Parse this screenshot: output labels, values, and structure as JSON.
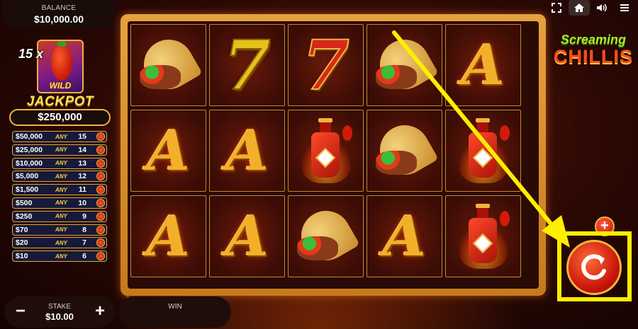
{
  "balance": {
    "label": "BALANCE",
    "value": "$10,000.00"
  },
  "wild": {
    "multiplier": "15 x",
    "label": "WILD"
  },
  "jackpot": {
    "title": "JACKPOT",
    "amount": "$250,000",
    "table": [
      {
        "amount": "$50,000",
        "any": "ANY",
        "count": "15"
      },
      {
        "amount": "$25,000",
        "any": "ANY",
        "count": "14"
      },
      {
        "amount": "$10,000",
        "any": "ANY",
        "count": "13"
      },
      {
        "amount": "$5,000",
        "any": "ANY",
        "count": "12"
      },
      {
        "amount": "$1,500",
        "any": "ANY",
        "count": "11"
      },
      {
        "amount": "$500",
        "any": "ANY",
        "count": "10"
      },
      {
        "amount": "$250",
        "any": "ANY",
        "count": "9"
      },
      {
        "amount": "$70",
        "any": "ANY",
        "count": "8"
      },
      {
        "amount": "$20",
        "any": "ANY",
        "count": "7"
      },
      {
        "amount": "$10",
        "any": "ANY",
        "count": "6"
      }
    ]
  },
  "stake": {
    "label": "STAKE",
    "value": "$10.00",
    "minus": "−",
    "plus": "+"
  },
  "win": {
    "label": "WIN"
  },
  "logo": {
    "line1": "Screaming",
    "line2": "CHILLIS"
  },
  "reels": [
    [
      "taco",
      "A",
      "A"
    ],
    [
      "7-yellow",
      "A",
      "A"
    ],
    [
      "7-red",
      "sauce",
      "taco"
    ],
    [
      "taco",
      "taco",
      "A"
    ],
    [
      "A",
      "sauce",
      "sauce"
    ]
  ],
  "symbols": {
    "A": "A",
    "seven": "7"
  },
  "buttons": {
    "spin": "C",
    "bet_plus": "+"
  },
  "icons": [
    "fullscreen-icon",
    "home-icon",
    "sound-icon",
    "menu-icon"
  ],
  "colors": {
    "highlight": "#ffee00",
    "gold": "#f2b43c",
    "reel_bg": "#3a0c05"
  }
}
